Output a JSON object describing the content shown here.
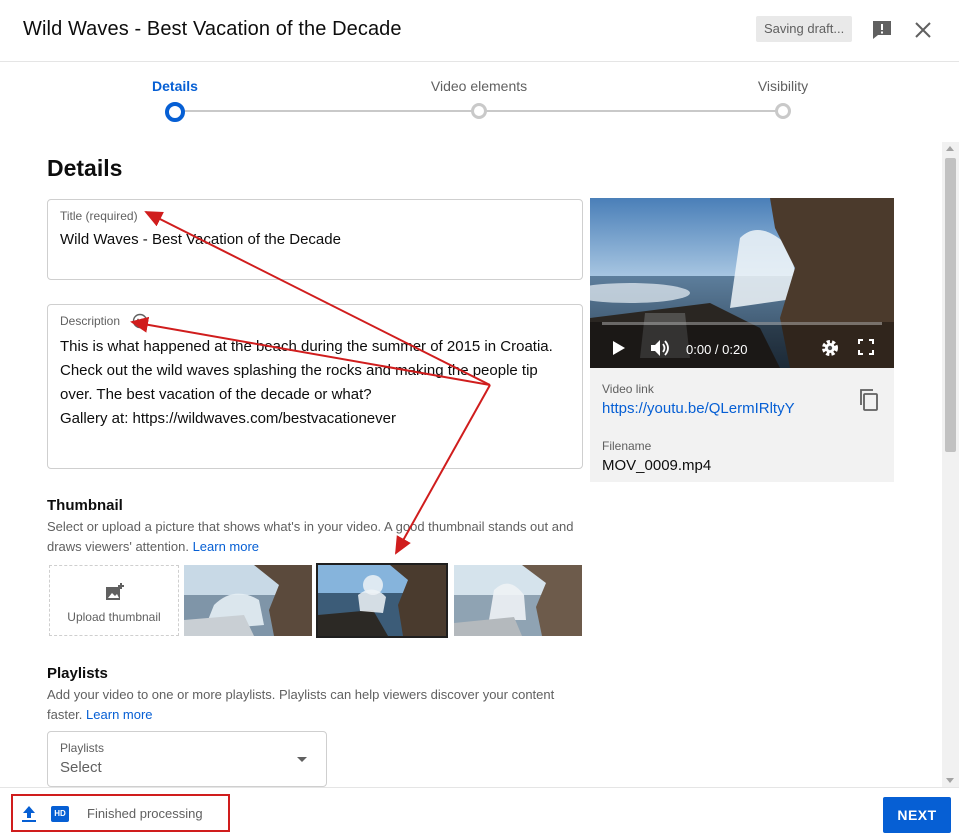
{
  "header": {
    "title": "Wild Waves - Best Vacation of the Decade",
    "saving_label": "Saving draft...",
    "feedback_icon": "feedback-icon",
    "close_icon": "close-icon"
  },
  "stepper": {
    "steps": [
      {
        "label": "Details",
        "active": true
      },
      {
        "label": "Video elements",
        "active": false
      },
      {
        "label": "Visibility",
        "active": false
      }
    ]
  },
  "details": {
    "heading": "Details",
    "title_field": {
      "label": "Title (required)",
      "value": "Wild Waves - Best Vacation of the Decade"
    },
    "description_field": {
      "label": "Description",
      "lines": [
        "This is what happened at the beach during the summer of 2015 in Croatia.",
        "Check out the wild waves splashing the rocks and making the people tip",
        "over. The best vacation of the decade or what?",
        "Gallery at: https://wildwaves.com/bestvacationever"
      ]
    },
    "thumbnail": {
      "heading": "Thumbnail",
      "help_text": "Select or upload a picture that shows what's in your video. A good thumbnail stands out and draws viewers' attention.",
      "learn_more": "Learn more",
      "upload_label": "Upload thumbnail",
      "selected_index": 1
    },
    "playlists": {
      "heading": "Playlists",
      "help_text": "Add your video to one or more playlists. Playlists can help viewers discover your content faster.",
      "learn_more": "Learn more",
      "select_label": "Playlists",
      "select_value": "Select"
    }
  },
  "video": {
    "time": "0:00 / 0:20",
    "link_label": "Video link",
    "link": "https://youtu.be/QLermIRltyY",
    "filename_label": "Filename",
    "filename": "MOV_0009.mp4"
  },
  "footer": {
    "hd_badge": "HD",
    "status": "Finished processing",
    "next_label": "NEXT"
  },
  "colors": {
    "accent": "#065fd4",
    "annotation": "#d01d1d"
  }
}
